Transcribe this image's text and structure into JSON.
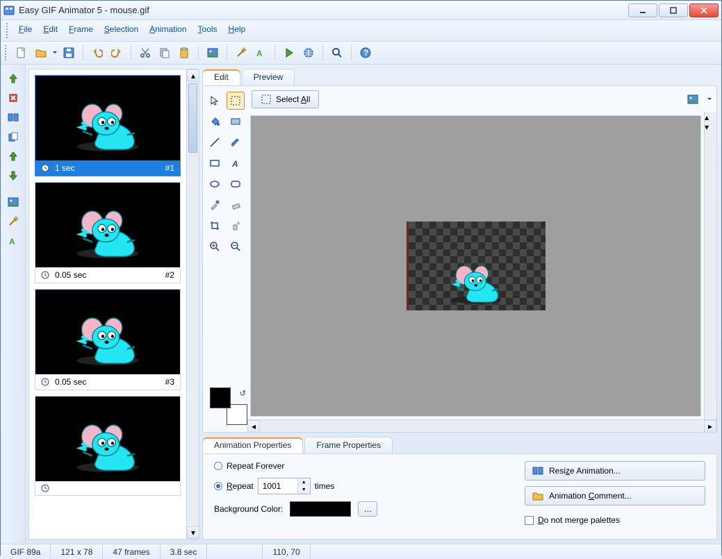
{
  "window": {
    "title": "Easy GIF Animator 5 - mouse.gif"
  },
  "menu": {
    "file": "File",
    "edit": "Edit",
    "frame": "Frame",
    "selection": "Selection",
    "animation": "Animation",
    "tools": "Tools",
    "help": "Help"
  },
  "toolbar_icons": {
    "new": "new-document",
    "open": "open-folder",
    "save": "save-disk",
    "undo": "undo",
    "redo": "redo",
    "cut": "cut-scissors",
    "copy": "copy",
    "paste": "paste",
    "image_tool": "image-magic",
    "wand": "magic-wand",
    "text": "text-tool",
    "play": "play",
    "export": "export-web",
    "zoom": "zoom",
    "help": "help-about"
  },
  "frame_toolbar_icons": {
    "insert": "insert-frame",
    "delete": "delete-frame",
    "select_all_frames": "select-all-frames",
    "duplicate": "duplicate-frame",
    "move_up": "move-frame-up",
    "move_down": "move-frame-down",
    "edit_image": "edit-frame-image",
    "wand": "frame-wand",
    "text_effect": "frame-text-effect"
  },
  "frames": [
    {
      "duration": "1 sec",
      "index": "#1",
      "selected": true
    },
    {
      "duration": "0.05 sec",
      "index": "#2",
      "selected": false
    },
    {
      "duration": "0.05 sec",
      "index": "#3",
      "selected": false
    },
    {
      "duration": "",
      "index": "",
      "selected": false
    }
  ],
  "main_tabs": {
    "edit": "Edit",
    "preview": "Preview"
  },
  "edit_area": {
    "select_all_label": "Select All",
    "tools": [
      "pointer",
      "marquee-select",
      "fill-bucket",
      "gradient",
      "line",
      "brush",
      "rectangle",
      "text-italic",
      "ellipse",
      "rounded-rect",
      "eyedropper",
      "eraser",
      "crop",
      "spray",
      "zoom-in",
      "zoom-out"
    ],
    "fg_color": "#000000",
    "bg_color": "#ffffff"
  },
  "properties_tabs": {
    "anim": "Animation Properties",
    "frame": "Frame Properties"
  },
  "animation_properties": {
    "repeat_forever_label": "Repeat Forever",
    "repeat_label": "Repeat",
    "repeat_value": "1001",
    "times_label": "times",
    "bgcolor_label": "Background Color:",
    "bgcolor_value": "#000000",
    "resize_label": "Resize Animation...",
    "comment_label": "Animation Comment...",
    "nomerge_label": "Do not merge palettes"
  },
  "statusbar": {
    "format": "GIF 89a",
    "dims": "121 x 78",
    "frames": "47 frames",
    "duration": "3.8 sec",
    "coords": "110, 70"
  }
}
